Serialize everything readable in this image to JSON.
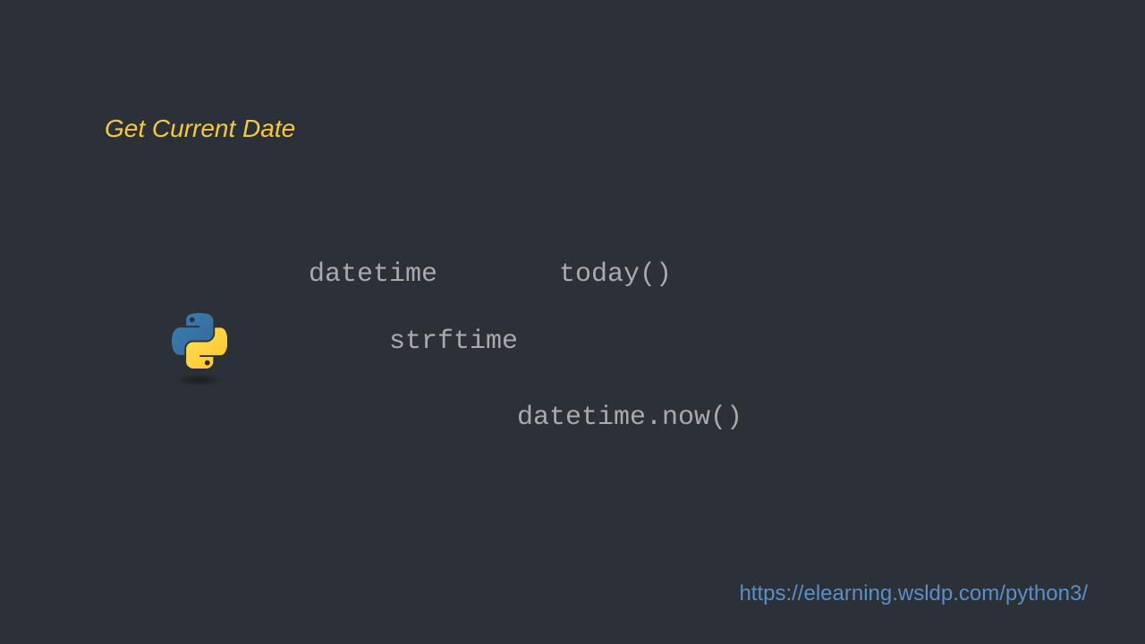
{
  "title": "Get Current Date",
  "code": {
    "datetime": "datetime",
    "today": "today()",
    "strftime": "strftime",
    "datetime_now": "datetime.now()"
  },
  "url": "https://elearning.wsldp.com/python3/"
}
